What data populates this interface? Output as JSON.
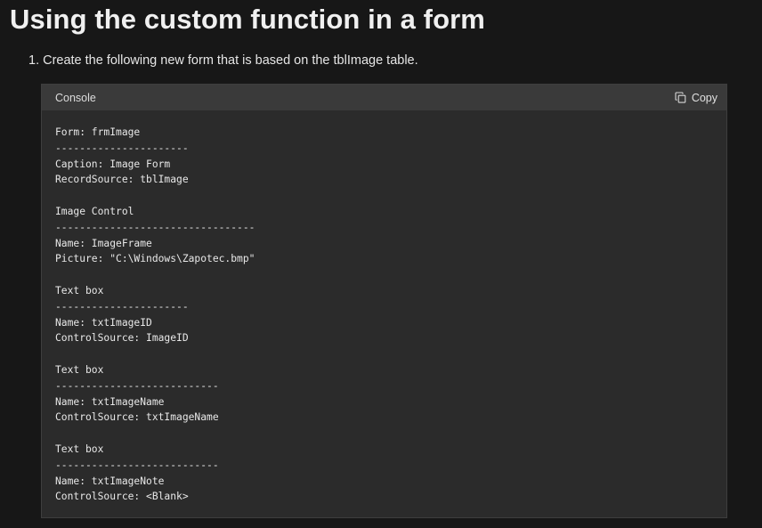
{
  "page": {
    "title": "Using the custom function in a form"
  },
  "steps": [
    {
      "number": "1.",
      "text": "Create the following new form that is based on the tblImage table."
    }
  ],
  "code_block": {
    "language_label": "Console",
    "copy_label": "Copy",
    "copy_icon": "copy-icon",
    "lines": [
      "Form: frmImage",
      "----------------------",
      "Caption: Image Form",
      "RecordSource: tblImage",
      "",
      "Image Control",
      "---------------------------------",
      "Name: ImageFrame",
      "Picture: \"C:\\Windows\\Zapotec.bmp\"",
      "",
      "Text box",
      "----------------------",
      "Name: txtImageID",
      "ControlSource: ImageID",
      "",
      "Text box",
      "---------------------------",
      "Name: txtImageName",
      "ControlSource: txtImageName",
      "",
      "Text box",
      "---------------------------",
      "Name: txtImageNote",
      "ControlSource: <Blank>"
    ]
  }
}
